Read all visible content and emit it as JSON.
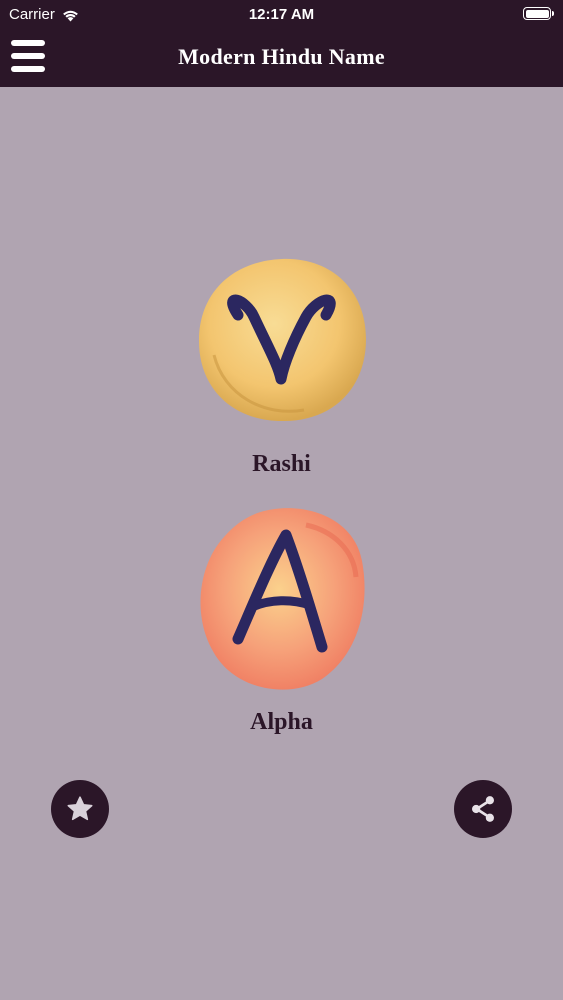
{
  "status_bar": {
    "carrier": "Carrier",
    "time": "12:17 AM",
    "wifi_icon": "wifi-icon",
    "battery_icon": "battery-full-icon"
  },
  "header": {
    "title": "Modern Hindu Name",
    "menu_icon": "hamburger-menu-icon"
  },
  "tiles": [
    {
      "label": "Rashi",
      "icon": "aries-symbol-icon",
      "color": "#f5cf7a"
    },
    {
      "label": "Alpha",
      "icon": "letter-a-icon",
      "color": "#f48a6a"
    }
  ],
  "actions": {
    "favorite_icon": "star-icon",
    "share_icon": "share-icon"
  },
  "colors": {
    "header_bg": "#2b1628",
    "page_bg": "#b0a4b1",
    "icon_ink": "#2b2760"
  }
}
